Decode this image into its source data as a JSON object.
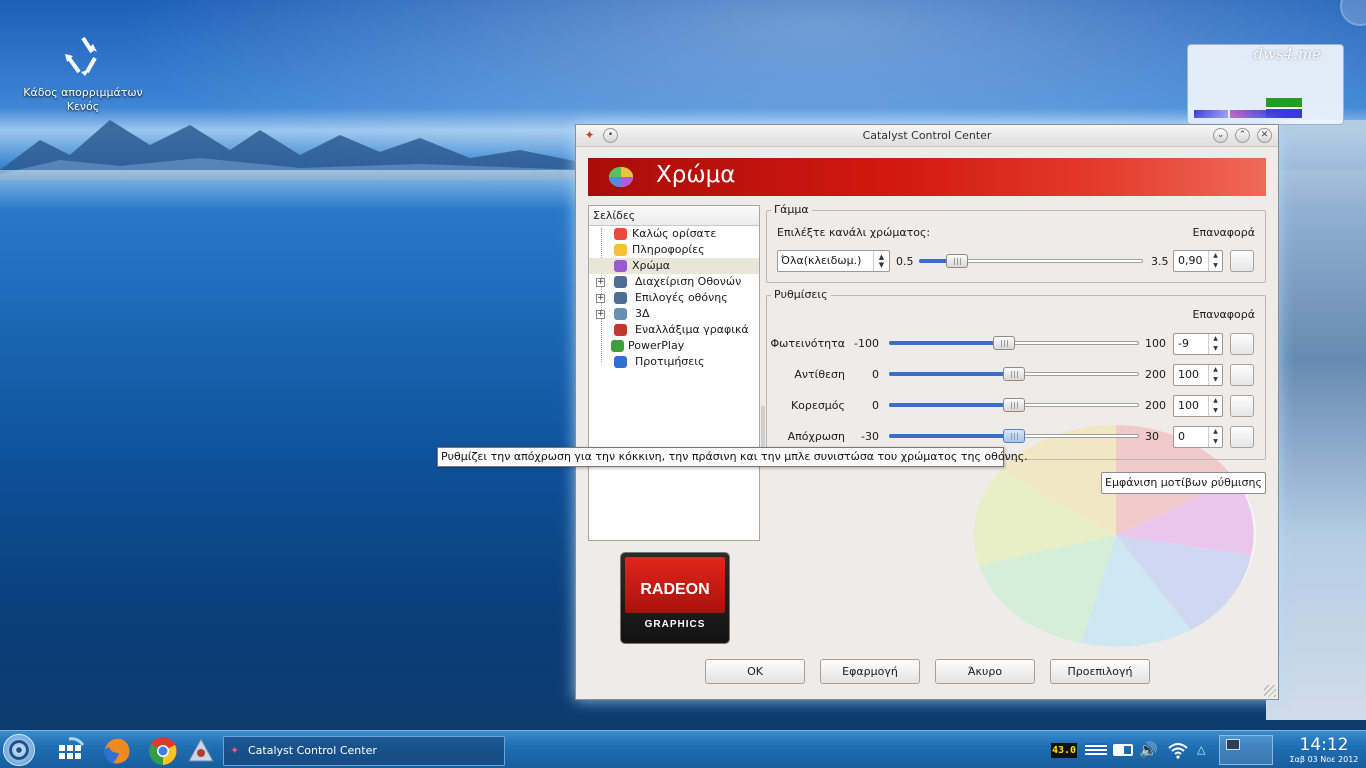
{
  "desktop": {
    "trash": {
      "label_line1": "Κάδος απορριμμάτων",
      "label_line2": "Κενός"
    },
    "widget": {
      "logo": "dws4.me"
    }
  },
  "window": {
    "title": "Catalyst Control Center",
    "banner_title": "Χρώμα",
    "pages": {
      "header": "Σελίδες",
      "items": [
        {
          "label": "Καλώς ορίσατε",
          "icon": "welcome-icon",
          "expandable": false,
          "selected": false
        },
        {
          "label": "Πληροφορίες",
          "icon": "info-icon",
          "expandable": false,
          "selected": false
        },
        {
          "label": "Χρώμα",
          "icon": "color-wheel-icon",
          "expandable": false,
          "selected": true
        },
        {
          "label": "Διαχείριση Οθονών",
          "icon": "display-manager-icon",
          "expandable": true,
          "selected": false
        },
        {
          "label": "Επιλογές οθόνης",
          "icon": "display-options-icon",
          "expandable": true,
          "selected": false
        },
        {
          "label": "3Δ",
          "icon": "3d-icon",
          "expandable": true,
          "selected": false
        },
        {
          "label": "Εναλλάξιμα γραφικά",
          "icon": "switchable-graphics-icon",
          "expandable": false,
          "selected": false
        },
        {
          "label": "PowerPlay",
          "icon": "powerplay-icon",
          "expandable": false,
          "selected": false
        },
        {
          "label": "Προτιμήσεις",
          "icon": "preferences-icon",
          "expandable": false,
          "selected": false
        }
      ]
    },
    "logo": {
      "line1": "RADEON",
      "line2": "GRAPHICS"
    },
    "gamma": {
      "group_title": "Γάμμα",
      "channel_label": "Επιλέξτε κανάλι χρώματος:",
      "reset_label": "Επαναφορά",
      "channel_value": "Όλα(κλειδωμ.)",
      "min_label": "0.5",
      "max_label": "3.5",
      "value": "0,90",
      "level": 0.9,
      "min": 0.5,
      "max": 3.5
    },
    "settings": {
      "group_title": "Ρυθμίσεις",
      "reset_label": "Επαναφορά",
      "rows": [
        {
          "label": "Φωτεινότητα",
          "min_label": "-100",
          "max_label": "100",
          "value": "-9",
          "level": -9,
          "min": -100,
          "max": 100,
          "active": false
        },
        {
          "label": "Αντίθεση",
          "min_label": "0",
          "max_label": "200",
          "value": "100",
          "level": 100,
          "min": 0,
          "max": 200,
          "active": false
        },
        {
          "label": "Κορεσμός",
          "min_label": "0",
          "max_label": "200",
          "value": "100",
          "level": 100,
          "min": 0,
          "max": 200,
          "active": false
        },
        {
          "label": "Απόχρωση",
          "min_label": "-30",
          "max_label": "30",
          "value": "0",
          "level": 0,
          "min": -30,
          "max": 30,
          "active": true
        }
      ]
    },
    "pattern_button": "Εμφάνιση μοτίβων ρύθμισης",
    "tooltip": "Ρυθμίζει την απόχρωση για την κόκκινη, την πράσινη και την μπλε συνιστώσα του χρώματος της οθόνης.",
    "buttons": {
      "ok": "OK",
      "apply": "Εφαρμογή",
      "cancel": "Άκυρο",
      "default": "Προεπιλογή"
    }
  },
  "taskbar": {
    "task_title": "Catalyst Control Center",
    "temperature": "43.0",
    "time": "14:12",
    "date": "Σαβ 03 Νοε 2012"
  },
  "colors": {
    "banner_red": "#d21810",
    "slider_fill": "#3b6fc5",
    "temp_text": "#ffe400"
  }
}
